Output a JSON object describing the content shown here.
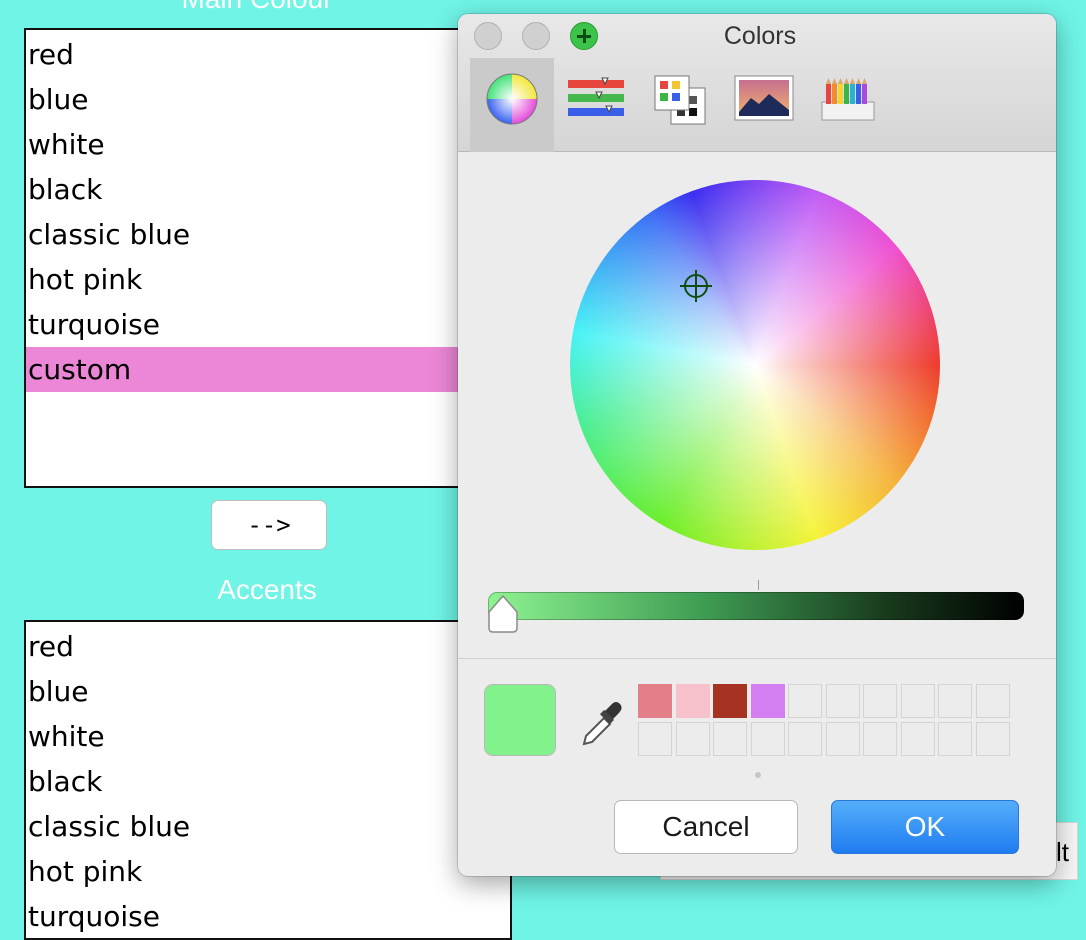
{
  "main_colour": {
    "title": "Main Colour",
    "items": [
      "red",
      "blue",
      "white",
      "black",
      "classic blue",
      "hot pink",
      "turquoise",
      "custom"
    ],
    "selected": "custom",
    "selected_color": "#eb87d6"
  },
  "arrow_button": {
    "label": "-->"
  },
  "accents": {
    "title": "Accents",
    "items": [
      "red",
      "blue",
      "white",
      "black",
      "classic blue",
      "hot pink",
      "turquoise"
    ]
  },
  "background_button": {
    "label_fragment": "lt"
  },
  "colors_panel": {
    "title": "Colors",
    "tabs": [
      {
        "icon": "color-wheel-icon",
        "active": true
      },
      {
        "icon": "color-sliders-icon",
        "active": false
      },
      {
        "icon": "color-palettes-icon",
        "active": false
      },
      {
        "icon": "image-palettes-icon",
        "active": false
      },
      {
        "icon": "pencils-icon",
        "active": false
      }
    ],
    "brightness_level": 0.0,
    "current_color": "#82f28c",
    "swatches": [
      "#e37f88",
      "#f6c1cb",
      "#a63221",
      "#d580f2"
    ],
    "buttons": {
      "cancel": "Cancel",
      "ok": "OK"
    }
  },
  "colors": {
    "background": "#6ff4e6",
    "ok_button": "#1f7cf1"
  }
}
